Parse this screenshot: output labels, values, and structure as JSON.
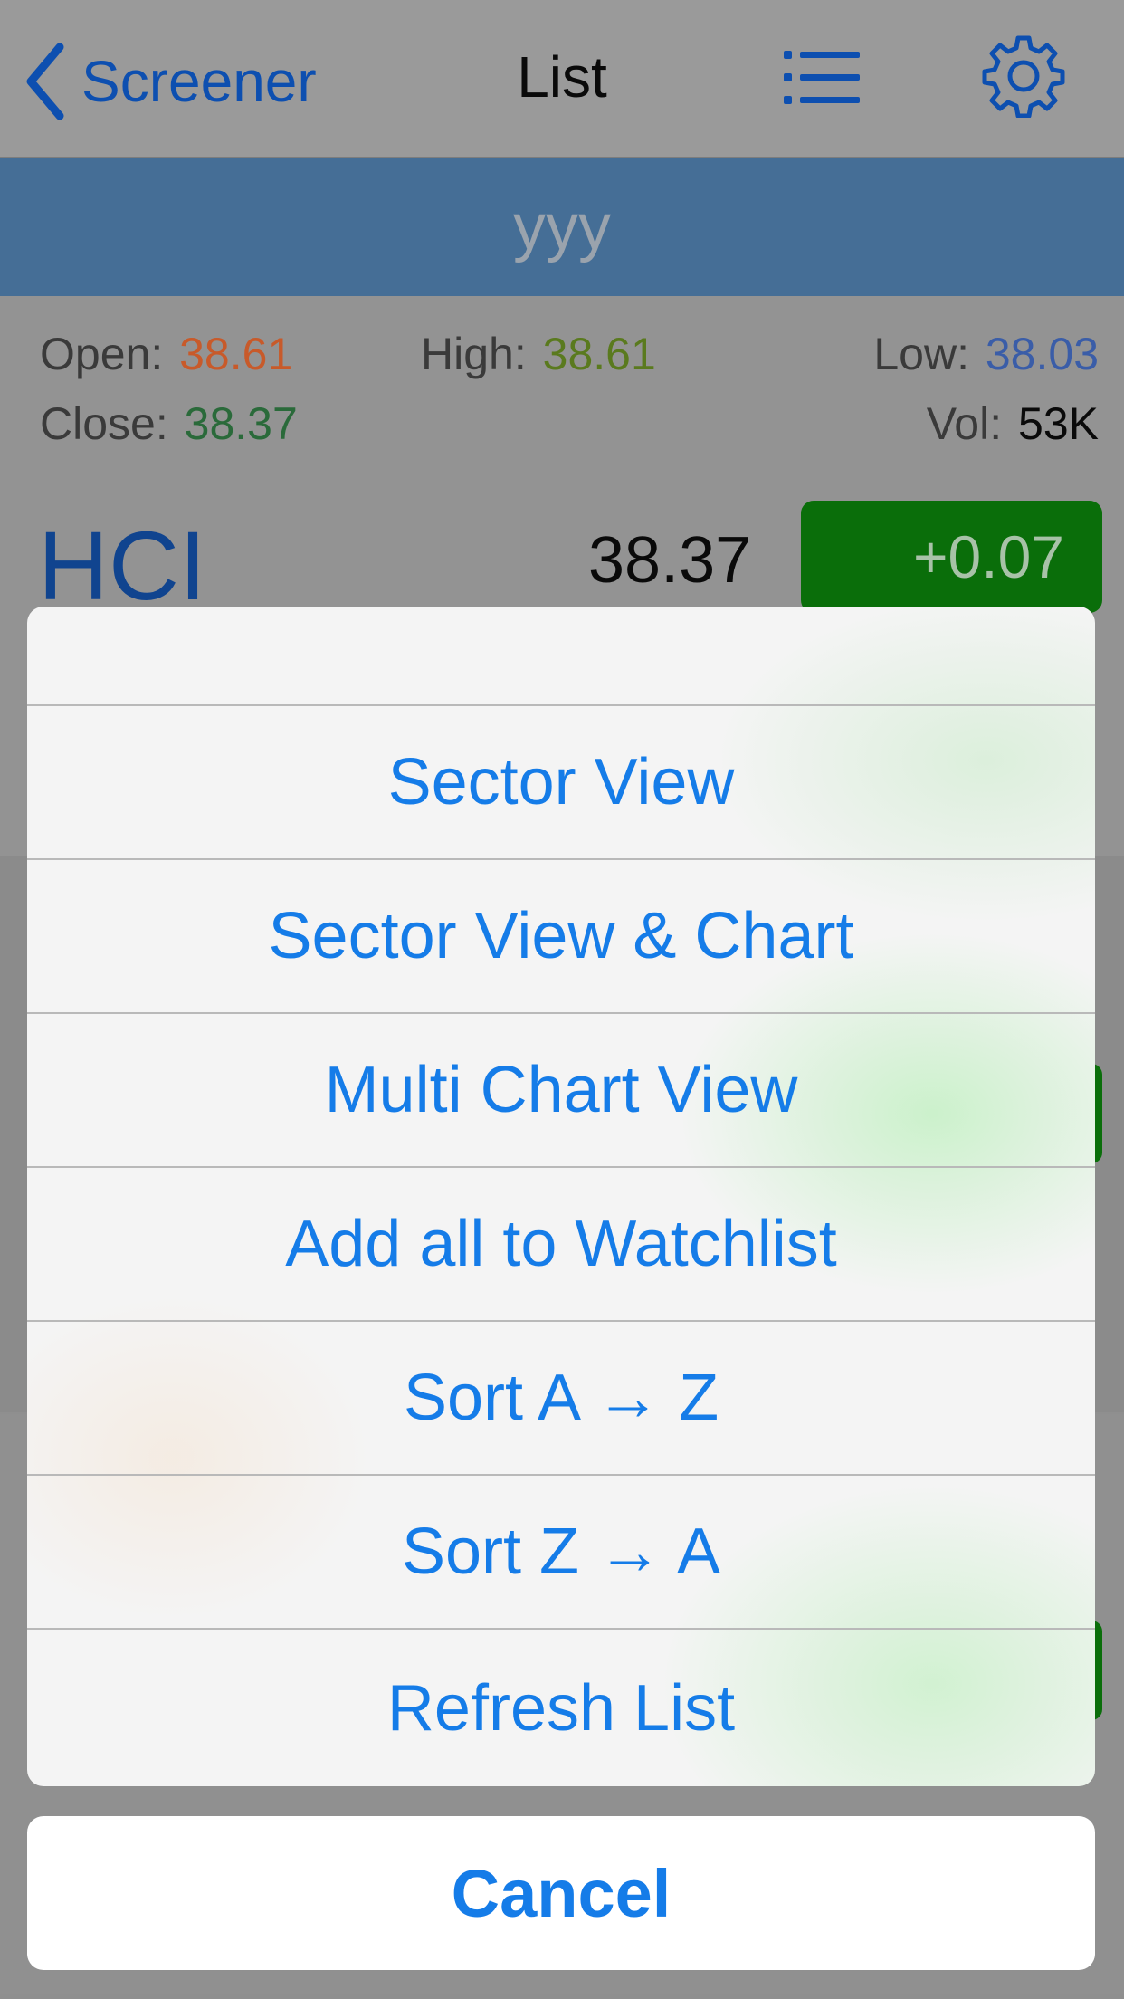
{
  "navbar": {
    "back_label": "Screener",
    "title": "List",
    "icons": [
      "chevron-left-icon",
      "list-icon",
      "gear-icon"
    ]
  },
  "banner": {
    "name": "yyy"
  },
  "quote": {
    "open_label": "Open:",
    "open_value": "38.61",
    "high_label": "High:",
    "high_value": "38.61",
    "low_label": "Low:",
    "low_value": "38.03",
    "close_label": "Close:",
    "close_value": "38.37",
    "vol_label": "Vol:",
    "vol_value": "53K",
    "symbol": "HCI",
    "price": "38.37",
    "change": "+0.07"
  },
  "action_sheet": {
    "items": [
      {
        "label": "Sector View"
      },
      {
        "label": "Sector View & Chart"
      },
      {
        "label": "Multi Chart View"
      },
      {
        "label": "Add all to Watchlist"
      },
      {
        "label": "Sort  A → Z"
      },
      {
        "label": "Sort  Z → A"
      },
      {
        "label": "Refresh List"
      }
    ],
    "cancel_label": "Cancel"
  },
  "colors": {
    "accent": "#157ce8",
    "open_value": "#c85a2a",
    "high_value": "#5a7a1e",
    "low_value": "#3a5da8",
    "close_value": "#2a6a3a",
    "change_badge": "#0a6e0a",
    "banner": "#456e96"
  }
}
